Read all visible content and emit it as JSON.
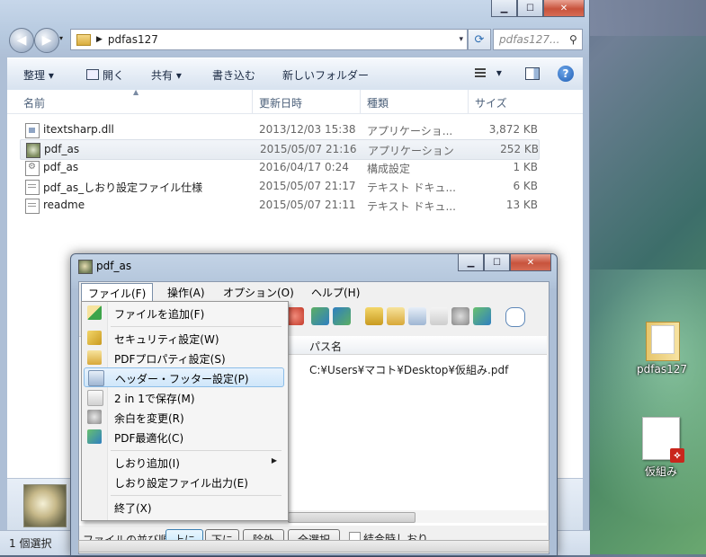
{
  "explorer": {
    "address_path": "pdfas127",
    "search_placeholder": "pdfas127...",
    "toolbar": {
      "organize": "整理 ▾",
      "open": "開く",
      "share": "共有 ▾",
      "burn": "書き込む",
      "new_folder": "新しいフォルダー",
      "views": "▾",
      "help": "?"
    },
    "columns": {
      "name": "名前",
      "date": "更新日時",
      "type": "種類",
      "size": "サイズ"
    },
    "files": [
      {
        "name": "itextsharp.dll",
        "date": "2013/12/03 15:38",
        "type": "アプリケーショ...",
        "size": "3,872 KB",
        "icon": "dll-file-icon"
      },
      {
        "name": "pdf_as",
        "date": "2015/05/07 21:16",
        "type": "アプリケーション",
        "size": "252 KB",
        "icon": "app-file-icon"
      },
      {
        "name": "pdf_as",
        "date": "2016/04/17 0:24",
        "type": "構成設定",
        "size": "1 KB",
        "icon": "config-file-icon"
      },
      {
        "name": "pdf_as_しおり設定ファイル仕様",
        "date": "2015/05/07 21:17",
        "type": "テキスト ドキュ...",
        "size": "6 KB",
        "icon": "text-file-icon"
      },
      {
        "name": "readme",
        "date": "2015/05/07 21:11",
        "type": "テキスト ドキュ...",
        "size": "13 KB",
        "icon": "text-file-icon"
      }
    ],
    "status": "1 個選択"
  },
  "desktop": {
    "folder_label": "pdfas127",
    "pdf_label": "仮組み"
  },
  "app": {
    "title": "pdf_as",
    "menus": [
      "ファイル(F)",
      "操作(A)",
      "オプション(O)",
      "ヘルプ(H)"
    ],
    "list_header": "パス名",
    "list_rows": [
      "C:¥Users¥マコト¥Desktop¥仮組み.pdf"
    ],
    "order_label": "ファイルの並び順:",
    "btn_up": "上に",
    "btn_down": "下に",
    "btn_remove": "除外",
    "btn_select_all": "全選択",
    "combine_bookmark": "結合時しおり"
  },
  "file_menu": [
    {
      "label": "ファイルを追加(F)"
    },
    {
      "label": "セキュリティ設定(W)"
    },
    {
      "label": "PDFプロパティ設定(S)"
    },
    {
      "label": "ヘッダー・フッター設定(P)",
      "highlighted": true
    },
    {
      "label": "2 in 1で保存(M)"
    },
    {
      "label": "余白を変更(R)"
    },
    {
      "label": "PDF最適化(C)"
    },
    {
      "label": "しおり追加(I)",
      "submenu": true
    },
    {
      "label": "しおり設定ファイル出力(E)"
    },
    {
      "label": "終了(X)"
    }
  ],
  "colors": {
    "accent": "#3c7fb1",
    "menu_highlight": "#cfe6fa",
    "close_button": "#c8533c"
  }
}
